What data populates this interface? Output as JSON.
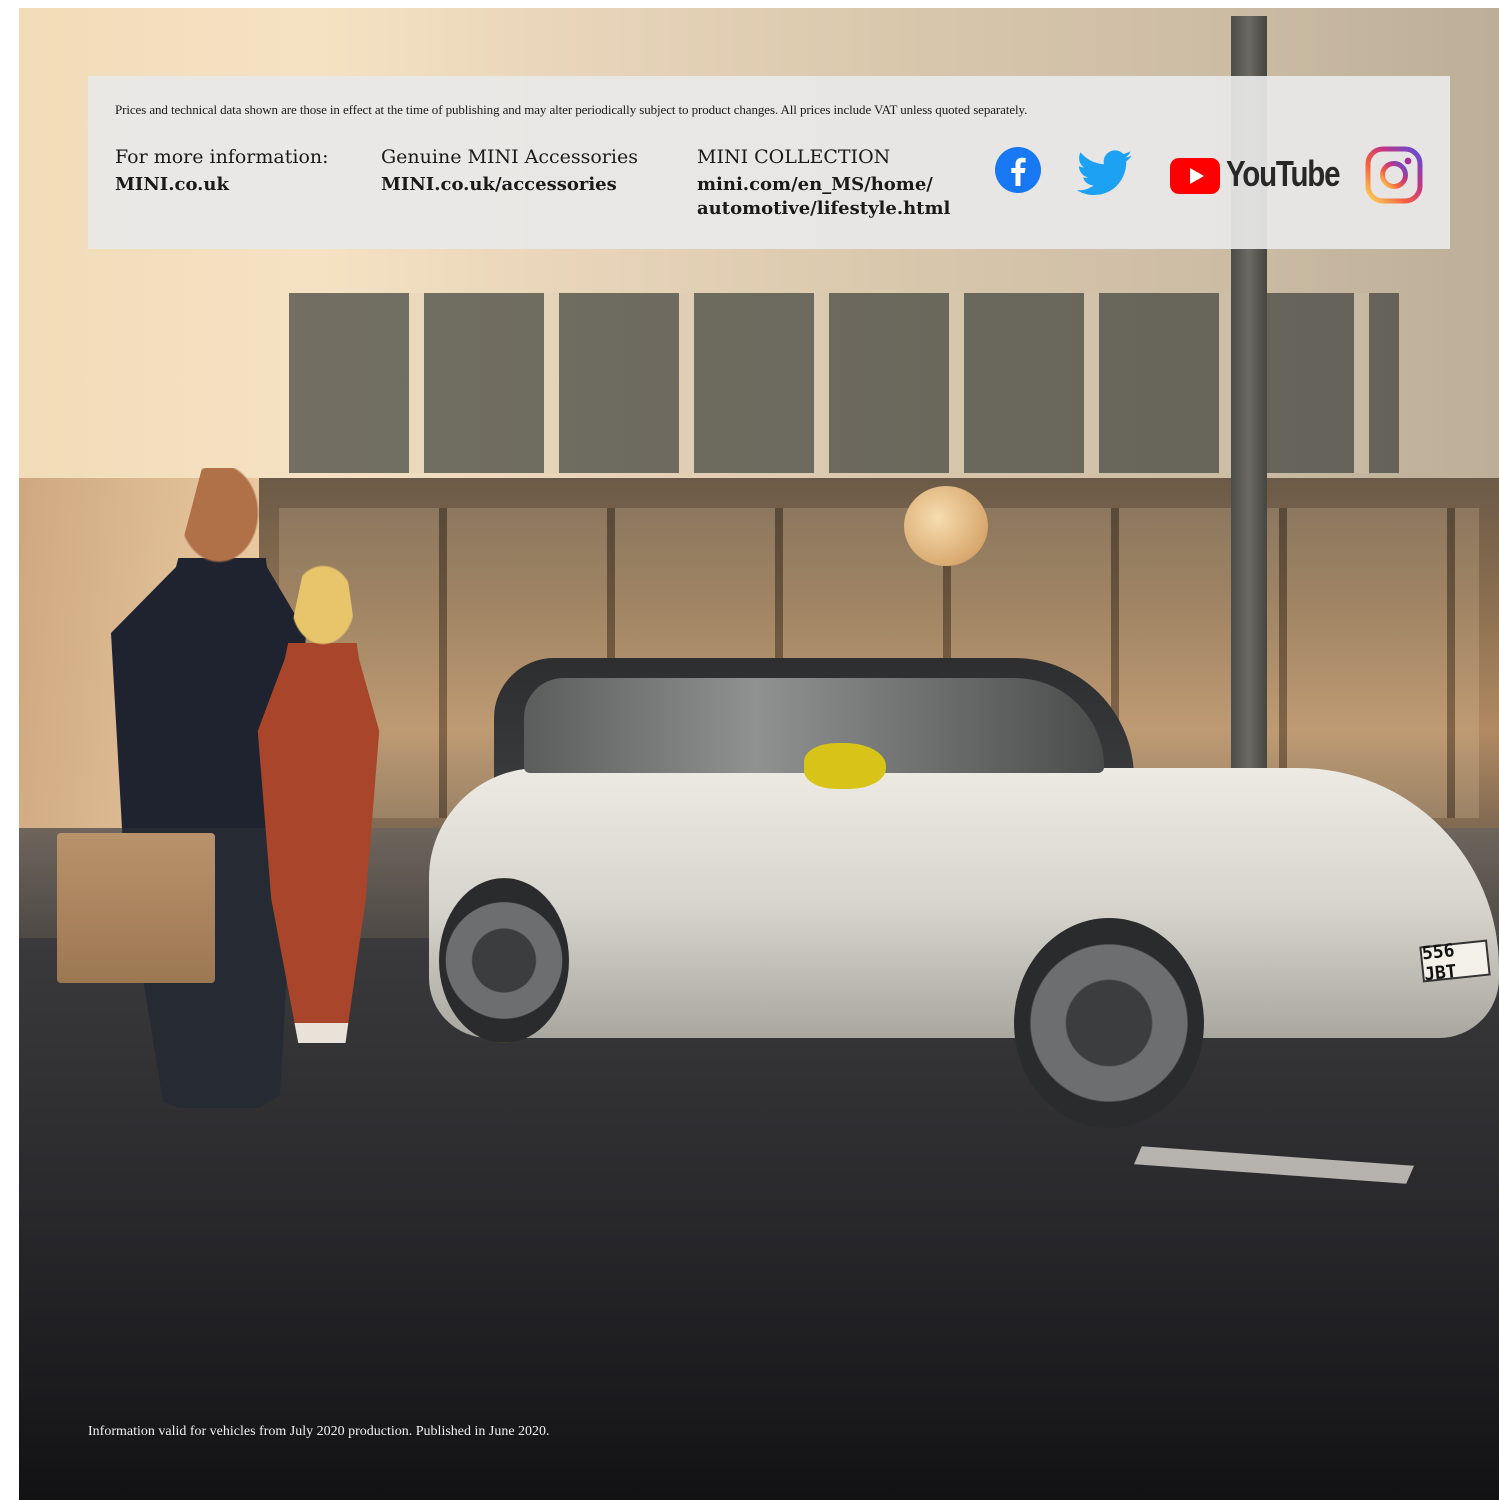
{
  "disclaimer": "Prices and technical data shown are those in effect at the time of publishing and may alter periodically subject to product changes. All prices include VAT unless quoted separately.",
  "info_columns": [
    {
      "label": "For more information:",
      "link": "MINI.co.uk"
    },
    {
      "label": "Genuine MINI Accessories",
      "link": "MINI.co.uk/accessories"
    },
    {
      "label": "MINI COLLECTION",
      "link_line1": "mini.com/en_MS/home/",
      "link_line2": "automotive/lifestyle.html"
    }
  ],
  "social": {
    "youtube_label": "YouTube",
    "icons": [
      "facebook-icon",
      "twitter-icon",
      "youtube-icon",
      "instagram-icon"
    ],
    "colors": {
      "facebook": "#1877f2",
      "twitter": "#1da1f2",
      "youtube": "#ff0000",
      "youtube_text": "#282828"
    }
  },
  "car": {
    "plate": "556 JBT",
    "accent_color": "#d8c418"
  },
  "footer": "Information valid for vehicles from July 2020 production. Published in June 2020."
}
